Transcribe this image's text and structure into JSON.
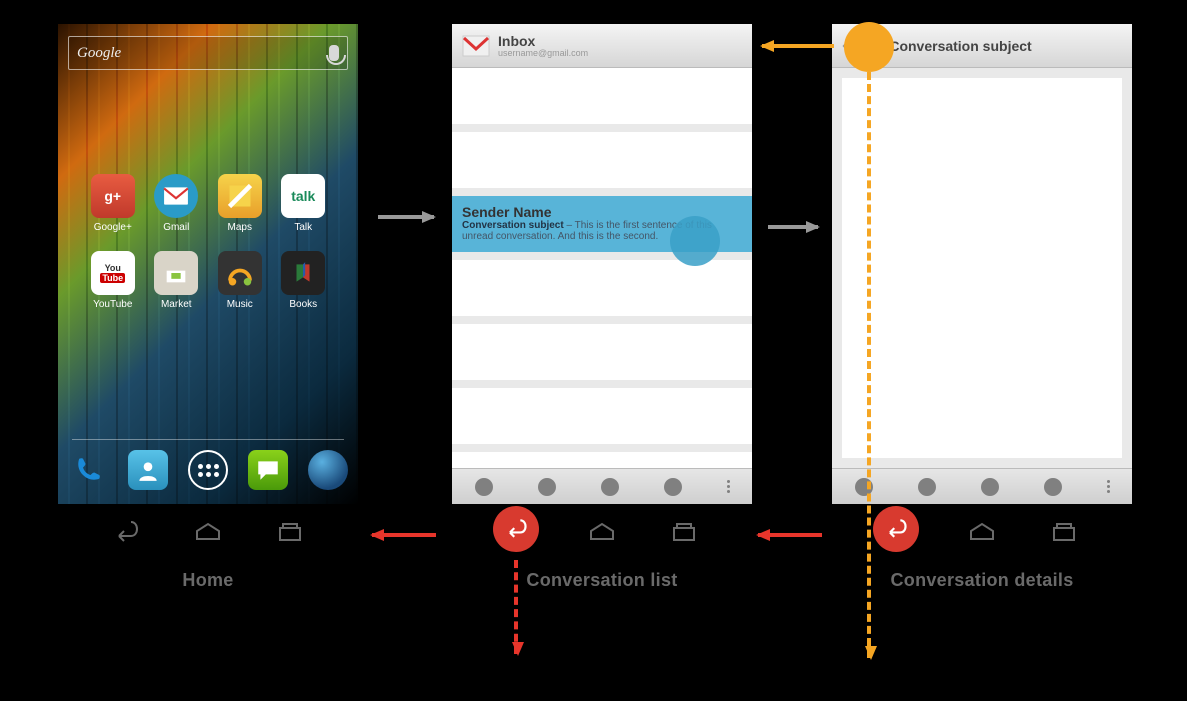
{
  "labels": {
    "home": "Home",
    "list": "Conversation list",
    "details": "Conversation details"
  },
  "home": {
    "search_placeholder": "Google",
    "apps": {
      "gplus": "Google+",
      "gmail": "Gmail",
      "maps": "Maps",
      "talk": "Talk",
      "youtube": "YouTube",
      "market": "Market",
      "music": "Music",
      "books": "Books"
    },
    "talk_label": "talk",
    "gplus_glyph": "g+",
    "yt_top": "You",
    "yt_bottom": "Tube"
  },
  "inbox": {
    "title": "Inbox",
    "subtitle": "username@gmail.com",
    "selected": {
      "sender": "Sender Name",
      "subject_bold": "Conversation subject",
      "preview_sep": " – ",
      "preview": "This is the first sentence of this unread conversation. And this is the second."
    }
  },
  "details": {
    "title": "Conversation subject"
  },
  "colors": {
    "red": "#e7352b",
    "orange": "#f5a623",
    "gray": "#999999",
    "touch_blue": "#3aa0c8"
  }
}
